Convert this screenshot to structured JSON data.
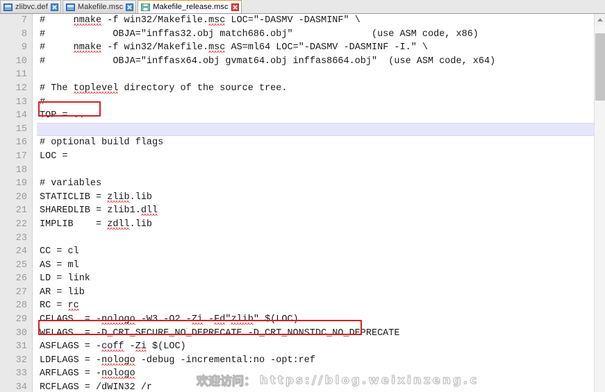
{
  "window": {
    "title": "Makefile_release.msc",
    "accent_orange": "#f0922b",
    "annotation_red": "#d32020",
    "current_line_bg": "#e6e6fa",
    "gutter_bg": "#e9e9e9"
  },
  "tabbar": {
    "tabs": [
      {
        "label": "zlibvc.def",
        "active": false,
        "icon": "file-blue-icon",
        "close": "close-icon"
      },
      {
        "label": "Makefile.msc",
        "active": false,
        "icon": "file-blue-icon",
        "close": "close-icon"
      },
      {
        "label": "Makefile_release.msc",
        "active": true,
        "icon": "save-green-icon",
        "close": "close-icon"
      }
    ]
  },
  "editor": {
    "first_visible_line": 7,
    "current_line": 15,
    "lines": [
      {
        "n": "7",
        "text": "#     nmake -f win32/Makefile.msc LOC=\"-DASMV -DASMINF\" \\"
      },
      {
        "n": "8",
        "text": "#            OBJA=\"inffas32.obj match686.obj\"              (use ASM code, x86)"
      },
      {
        "n": "9",
        "text": "#     nmake -f win32/Makefile.msc AS=ml64 LOC=\"-DASMV -DASMINF -I.\" \\"
      },
      {
        "n": "10",
        "text": "#            OBJA=\"inffasx64.obj gvmat64.obj inffas8664.obj\"  (use ASM code, x64)"
      },
      {
        "n": "11",
        "text": ""
      },
      {
        "n": "12",
        "text": "# The toplevel directory of the source tree."
      },
      {
        "n": "13",
        "text": "#"
      },
      {
        "n": "14",
        "text": "TOP = .."
      },
      {
        "n": "15",
        "text": ""
      },
      {
        "n": "16",
        "text": "# optional build flags"
      },
      {
        "n": "17",
        "text": "LOC ="
      },
      {
        "n": "18",
        "text": ""
      },
      {
        "n": "19",
        "text": "# variables"
      },
      {
        "n": "20",
        "text": "STATICLIB = zlib.lib"
      },
      {
        "n": "21",
        "text": "SHAREDLIB = zlib1.dll"
      },
      {
        "n": "22",
        "text": "IMPLIB    = zdll.lib"
      },
      {
        "n": "23",
        "text": ""
      },
      {
        "n": "24",
        "text": "CC = cl"
      },
      {
        "n": "25",
        "text": "AS = ml"
      },
      {
        "n": "26",
        "text": "LD = link"
      },
      {
        "n": "27",
        "text": "AR = lib"
      },
      {
        "n": "28",
        "text": "RC = rc"
      },
      {
        "n": "29",
        "text": "CFLAGS  = -nologo -W3 -O2 -Zi -Fd\"zlib\" $(LOC)"
      },
      {
        "n": "30",
        "text": "WFLAGS  = -D_CRT_SECURE_NO_DEPRECATE -D_CRT_NONSTDC_NO_DEPRECATE"
      },
      {
        "n": "31",
        "text": "ASFLAGS = -coff -Zi $(LOC)"
      },
      {
        "n": "32",
        "text": "LDFLAGS = -nologo -debug -incremental:no -opt:ref"
      },
      {
        "n": "33",
        "text": "ARFLAGS = -nologo"
      },
      {
        "n": "34",
        "text": "RCFLAGS = /dWIN32 /r"
      }
    ],
    "annotations": [
      {
        "name": "highlight-box-top",
        "target_line": "14",
        "label": "TOP = .."
      },
      {
        "name": "highlight-box-cflags",
        "target_line": "29",
        "label": "CFLAGS  = -nologo -W3 -O2 -Zi -Fd\"zlib\" $(LOC)"
      }
    ]
  },
  "scrollbar": {
    "up_arrow": "scroll-up-arrow-icon",
    "thumb_name": "vertical-scroll-thumb"
  },
  "watermark": {
    "cn": "欢迎访问：",
    "url": "https://blog.weixinzeng.c"
  }
}
